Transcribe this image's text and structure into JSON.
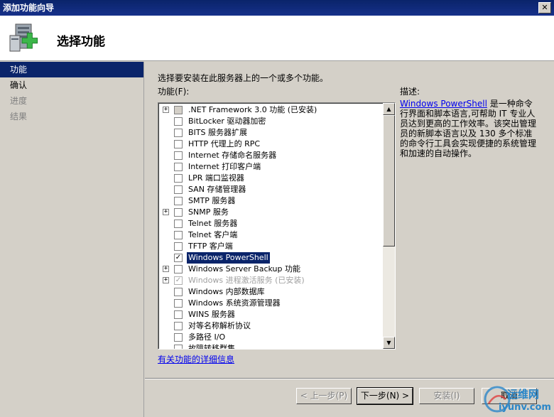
{
  "window": {
    "title": "添加功能向导",
    "close_glyph": "✕"
  },
  "header": {
    "title": "选择功能",
    "icon": "server-add-icon"
  },
  "sidebar": {
    "steps": [
      {
        "label": "功能",
        "state": "active"
      },
      {
        "label": "确认",
        "state": "enabled"
      },
      {
        "label": "进度",
        "state": "disabled"
      },
      {
        "label": "结果",
        "state": "disabled"
      }
    ]
  },
  "main": {
    "instruction": "选择要安装在此服务器上的一个或多个功能。",
    "features_label": "功能(F):",
    "features": [
      {
        "label": ".NET Framework 3.0 功能  (已安装)",
        "expandable": true,
        "checked": "partial"
      },
      {
        "label": "BitLocker 驱动器加密",
        "expandable": false,
        "checked": "none"
      },
      {
        "label": "BITS 服务器扩展",
        "expandable": false,
        "checked": "none"
      },
      {
        "label": "HTTP 代理上的 RPC",
        "expandable": false,
        "checked": "none"
      },
      {
        "label": "Internet 存储命名服务器",
        "expandable": false,
        "checked": "none"
      },
      {
        "label": "Internet 打印客户端",
        "expandable": false,
        "checked": "none"
      },
      {
        "label": "LPR 端口监视器",
        "expandable": false,
        "checked": "none"
      },
      {
        "label": "SAN 存储管理器",
        "expandable": false,
        "checked": "none"
      },
      {
        "label": "SMTP 服务器",
        "expandable": false,
        "checked": "none"
      },
      {
        "label": "SNMP 服务",
        "expandable": true,
        "checked": "none"
      },
      {
        "label": "Telnet 服务器",
        "expandable": false,
        "checked": "none"
      },
      {
        "label": "Telnet 客户端",
        "expandable": false,
        "checked": "none"
      },
      {
        "label": "TFTP 客户端",
        "expandable": false,
        "checked": "none"
      },
      {
        "label": "Windows PowerShell",
        "expandable": false,
        "checked": "checked",
        "selected": true
      },
      {
        "label": "Windows Server Backup 功能",
        "expandable": true,
        "checked": "none"
      },
      {
        "label": "Windows 进程激活服务  (已安装)",
        "expandable": true,
        "checked": "checked",
        "disabled": true
      },
      {
        "label": "Windows 内部数据库",
        "expandable": false,
        "checked": "none"
      },
      {
        "label": "Windows 系统资源管理器",
        "expandable": false,
        "checked": "none"
      },
      {
        "label": "WINS 服务器",
        "expandable": false,
        "checked": "none"
      },
      {
        "label": "对等名称解析协议",
        "expandable": false,
        "checked": "none"
      },
      {
        "label": "多路径 I/O",
        "expandable": false,
        "checked": "none"
      },
      {
        "label": "故障转移群集",
        "expandable": false,
        "checked": "none"
      }
    ],
    "detail_link": "有关功能的详细信息",
    "scroll_up": "▲",
    "scroll_down": "▼"
  },
  "description": {
    "label": "描述:",
    "link": "Windows PowerShell",
    "text": " 是一种命令行界面和脚本语言,可帮助 IT 专业人员达到更高的工作效率。该突出管理员的新脚本语言以及 130 多个标准的命令行工具会实现便捷的系统管理和加速的自动操作。"
  },
  "buttons": {
    "back": "< 上一步(P)",
    "next": "下一步(N) >",
    "install": "安装(I)",
    "cancel": "取消"
  },
  "watermark": {
    "name": "运维网",
    "url": "iyunv.com"
  },
  "colors": {
    "accent": "#0a246a",
    "link": "#0000ee",
    "face": "#d4d0c8"
  }
}
